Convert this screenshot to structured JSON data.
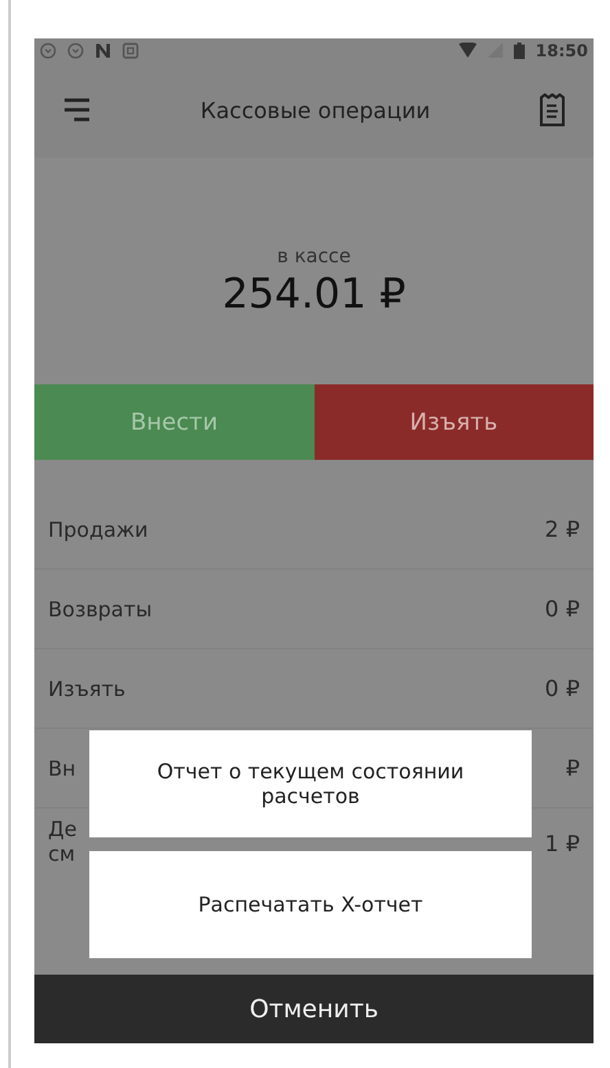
{
  "status_bar": {
    "time": "18:50"
  },
  "toolbar": {
    "title": "Кассовые операции"
  },
  "balance": {
    "label": "в кассе",
    "amount": "254.01 ₽"
  },
  "actions": [
    {
      "kind": "deposit",
      "label": "Внести"
    },
    {
      "kind": "withdraw",
      "label": "Изъять"
    }
  ],
  "rows": [
    {
      "label_lines": [
        "Продажи"
      ],
      "value": "2 ₽"
    },
    {
      "label_lines": [
        "Возвраты"
      ],
      "value": "0 ₽"
    },
    {
      "label_lines": [
        "Изъять"
      ],
      "value": "0 ₽"
    },
    {
      "label_lines": [
        "Вн"
      ],
      "value": "₽"
    },
    {
      "label_lines": [
        "Де",
        "см"
      ],
      "value": "1 ₽"
    }
  ],
  "dialog": {
    "options": [
      "Отчет о текущем состоянии расчетов",
      "Распечатать X-отчет"
    ]
  },
  "cancel_button": "Отменить"
}
